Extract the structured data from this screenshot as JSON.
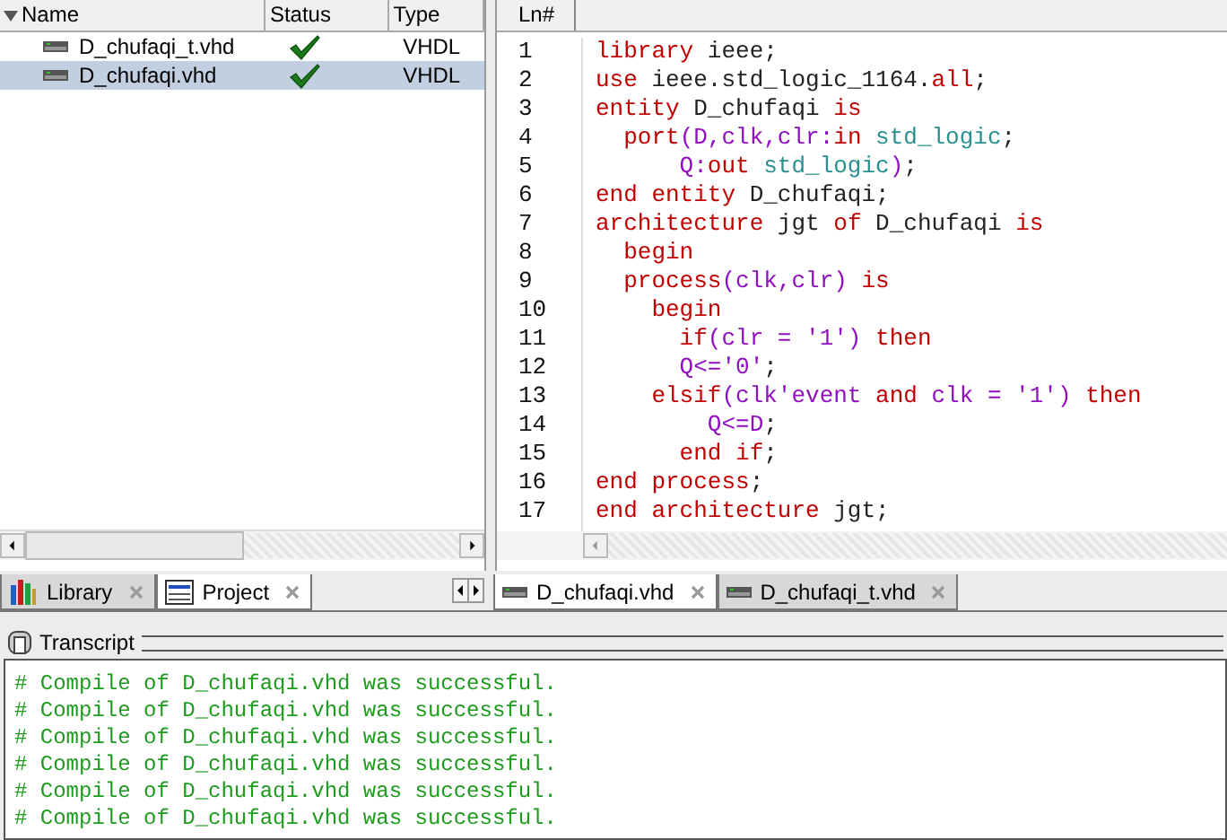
{
  "library": {
    "columns": [
      "Name",
      "Status",
      "Type"
    ],
    "rows": [
      {
        "name": "D_chufaqi_t.vhd",
        "compiled": true,
        "type": "VHDL",
        "selected": false
      },
      {
        "name": "D_chufaqi.vhd",
        "compiled": true,
        "type": "VHDL",
        "selected": true
      }
    ]
  },
  "panel_tabs": [
    {
      "label": "Library",
      "kind": "library",
      "selected": false
    },
    {
      "label": "Project",
      "kind": "project",
      "selected": true
    }
  ],
  "editor": {
    "header": "Ln#",
    "lines": [
      {
        "number": "1",
        "tokens": [
          {
            "kind": "kw",
            "text": "library"
          },
          {
            "kind": "id",
            "text": " ieee;"
          }
        ]
      },
      {
        "number": "2",
        "tokens": [
          {
            "kind": "kw",
            "text": "use"
          },
          {
            "kind": "id",
            "text": " ieee.std_logic_1164."
          },
          {
            "kind": "kw",
            "text": "all"
          },
          {
            "kind": "id",
            "text": ";"
          }
        ]
      },
      {
        "number": "3",
        "tokens": [
          {
            "kind": "kw",
            "text": "entity"
          },
          {
            "kind": "id",
            "text": " D_chufaqi "
          },
          {
            "kind": "kw",
            "text": "is"
          }
        ]
      },
      {
        "number": "4",
        "tokens": [
          {
            "kind": "kw",
            "text": "  port"
          },
          {
            "kind": "pu",
            "text": "(D,clk,clr:"
          },
          {
            "kind": "kw",
            "text": "in"
          },
          {
            "kind": "ty",
            "text": " std_logic"
          },
          {
            "kind": "id",
            "text": ";"
          }
        ]
      },
      {
        "number": "5",
        "tokens": [
          {
            "kind": "pu",
            "text": "      Q:"
          },
          {
            "kind": "kw",
            "text": "out"
          },
          {
            "kind": "ty",
            "text": " std_logic"
          },
          {
            "kind": "pu",
            "text": ")"
          },
          {
            "kind": "id",
            "text": ";"
          }
        ]
      },
      {
        "number": "6",
        "tokens": [
          {
            "kind": "kw",
            "text": "end entity"
          },
          {
            "kind": "id",
            "text": " D_chufaqi;"
          }
        ]
      },
      {
        "number": "7",
        "tokens": [
          {
            "kind": "kw",
            "text": "architecture"
          },
          {
            "kind": "id",
            "text": " jgt "
          },
          {
            "kind": "kw",
            "text": "of"
          },
          {
            "kind": "id",
            "text": " D_chufaqi "
          },
          {
            "kind": "kw",
            "text": "is"
          }
        ]
      },
      {
        "number": "8",
        "tokens": [
          {
            "kind": "kw",
            "text": "  begin"
          }
        ]
      },
      {
        "number": "9",
        "tokens": [
          {
            "kind": "kw",
            "text": "  process"
          },
          {
            "kind": "pu",
            "text": "(clk,clr)"
          },
          {
            "kind": "kw",
            "text": " is"
          }
        ]
      },
      {
        "number": "10",
        "tokens": [
          {
            "kind": "kw",
            "text": "    begin"
          }
        ]
      },
      {
        "number": "11",
        "tokens": [
          {
            "kind": "kw",
            "text": "      if"
          },
          {
            "kind": "pu",
            "text": "(clr = '1')"
          },
          {
            "kind": "kw",
            "text": " then"
          }
        ]
      },
      {
        "number": "12",
        "tokens": [
          {
            "kind": "pu",
            "text": "      Q<='0'"
          },
          {
            "kind": "id",
            "text": ";"
          }
        ]
      },
      {
        "number": "13",
        "tokens": [
          {
            "kind": "kw",
            "text": "    elsif"
          },
          {
            "kind": "pu",
            "text": "(clk'event"
          },
          {
            "kind": "kw",
            "text": " and"
          },
          {
            "kind": "pu",
            "text": " clk = '1')"
          },
          {
            "kind": "kw",
            "text": " then"
          }
        ]
      },
      {
        "number": "14",
        "tokens": [
          {
            "kind": "pu",
            "text": "        Q<=D"
          },
          {
            "kind": "id",
            "text": ";"
          }
        ]
      },
      {
        "number": "15",
        "tokens": [
          {
            "kind": "kw",
            "text": "      end if"
          },
          {
            "kind": "id",
            "text": ";"
          }
        ]
      },
      {
        "number": "16",
        "tokens": [
          {
            "kind": "kw",
            "text": "end process"
          },
          {
            "kind": "id",
            "text": ";"
          }
        ]
      },
      {
        "number": "17",
        "tokens": [
          {
            "kind": "kw",
            "text": "end architecture"
          },
          {
            "kind": "id",
            "text": " jgt;"
          }
        ]
      }
    ]
  },
  "editor_tabs": [
    {
      "label": "D_chufaqi.vhd",
      "selected": true
    },
    {
      "label": "D_chufaqi_t.vhd",
      "selected": false
    }
  ],
  "transcript": {
    "title": "Transcript",
    "lines": [
      "# Compile of D_chufaqi.vhd was successful.",
      "# Compile of D_chufaqi.vhd was successful.",
      "# Compile of D_chufaqi.vhd was successful.",
      "# Compile of D_chufaqi.vhd was successful.",
      "# Compile of D_chufaqi.vhd was successful.",
      "# Compile of D_chufaqi.vhd was successful."
    ]
  }
}
